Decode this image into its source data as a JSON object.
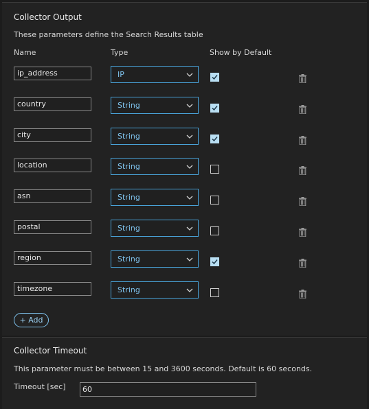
{
  "output": {
    "title": "Collector Output",
    "description": "These parameters define the Search Results table",
    "columns": {
      "name": "Name",
      "type": "Type",
      "show": "Show by Default"
    },
    "rows": [
      {
        "name": "ip_address",
        "type": "IP",
        "show": true
      },
      {
        "name": "country",
        "type": "String",
        "show": true
      },
      {
        "name": "city",
        "type": "String",
        "show": true
      },
      {
        "name": "location",
        "type": "String",
        "show": false
      },
      {
        "name": "asn",
        "type": "String",
        "show": false
      },
      {
        "name": "postal",
        "type": "String",
        "show": false
      },
      {
        "name": "region",
        "type": "String",
        "show": true
      },
      {
        "name": "timezone",
        "type": "String",
        "show": false
      }
    ],
    "add_label": "+ Add"
  },
  "timeout": {
    "title": "Collector Timeout",
    "description": "This parameter must be between 15 and 3600 seconds. Default is 60 seconds.",
    "label": "Timeout [sec]",
    "value": "60"
  },
  "colors": {
    "accent": "#49a3d9",
    "checkbox_checked": "#b9dff3",
    "background": "#222222"
  },
  "icons": {
    "select": "chevron-down-icon",
    "checkbox": "check-icon",
    "delete": "trash-icon"
  }
}
